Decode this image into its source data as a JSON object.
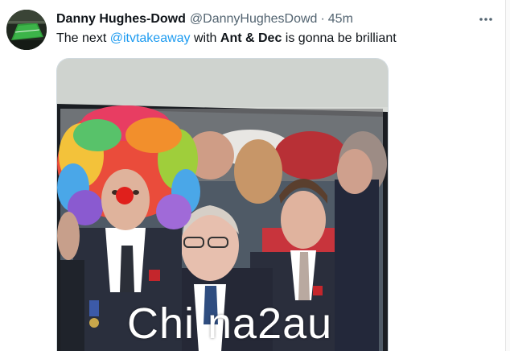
{
  "tweet": {
    "display_name": "Danny Hughes-Dowd",
    "handle": "@DannyHughesDowd",
    "separator": "·",
    "time": "45m",
    "text_before": "The next ",
    "mention": "@itvtakeaway",
    "text_middle": " with ",
    "bold_names": "Ant & Dec",
    "text_after": " is gonna be brilliant",
    "avatar_icon": "football-pitch-avatar",
    "more_icon": "more-horizontal-icon"
  },
  "media": {
    "watermark": "Chi na2au"
  },
  "colors": {
    "link": "#1d9bf0",
    "secondary_text": "#536471",
    "primary_text": "#0f1419"
  }
}
